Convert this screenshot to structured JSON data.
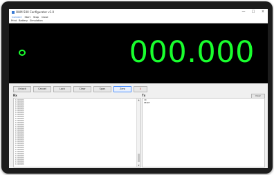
{
  "window": {
    "title": "OHM-500 Configurator v1.0",
    "controls": [
      "—",
      "□",
      "×"
    ]
  },
  "menu": {
    "items": [
      "Connect",
      "Start",
      "Stop",
      "Close"
    ]
  },
  "toolbar": {
    "items": [
      "Print",
      "Battery",
      "Simulation"
    ]
  },
  "display": {
    "reading": "000.000",
    "accent_color": "#19ff2e"
  },
  "buttons": {
    "unlock": "Unlock",
    "cancel": "Cancel",
    "lock": "Lock",
    "clear": "Clear",
    "span": "Span",
    "zero": "Zero",
    "extra": "X"
  },
  "rx": {
    "label": "Rx",
    "lines": [
      "0.000000",
      "0.000000",
      "0.000000",
      "0.000000",
      "0.000000",
      "0.000000",
      "0.000000",
      "0.000000",
      "0.000000",
      "0.000000",
      "0.000000",
      "0.000000",
      "0.000000",
      "0.000000",
      "0.000000",
      "0.000000",
      "0.000000",
      "0.000000",
      "0.000000",
      "0.000000",
      "0.000000",
      "0.000000",
      "0.000000",
      "0.000000",
      "0.000000",
      "0.000000",
      "0.000000",
      "0.000000",
      "0.000000",
      "0.000000",
      "0.000000",
      "0.000000"
    ]
  },
  "tx": {
    "label": "Tx",
    "clear_label": "Clear",
    "lines": [
      "CR",
      "READY"
    ]
  }
}
